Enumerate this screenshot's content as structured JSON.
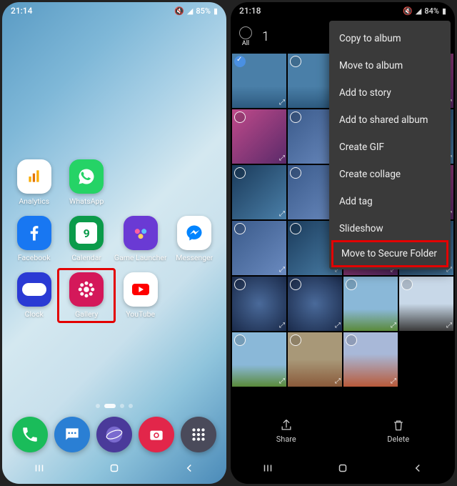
{
  "left": {
    "status": {
      "time": "21:14",
      "battery": "85%"
    },
    "apps": [
      {
        "name": "Analytics",
        "bg": "#fff",
        "icon": "analytics"
      },
      {
        "name": "WhatsApp",
        "bg": "#25d366",
        "icon": "whatsapp"
      },
      {
        "name": "Facebook",
        "bg": "#1877f2",
        "icon": "facebook"
      },
      {
        "name": "Calendar",
        "bg": "#0b9b4a",
        "icon": "calendar",
        "day": "9"
      },
      {
        "name": "Game Launcher",
        "bg": "#6a3ad4",
        "icon": "game"
      },
      {
        "name": "Messenger",
        "bg": "#fff",
        "icon": "messenger"
      },
      {
        "name": "Clock",
        "bg": "#2a3ad4",
        "icon": "clock"
      },
      {
        "name": "Gallery",
        "bg": "#d4185a",
        "icon": "gallery",
        "highlighted": true
      },
      {
        "name": "YouTube",
        "bg": "#fff",
        "icon": "youtube"
      }
    ],
    "dock": [
      {
        "name": "phone",
        "bg": "#1abc5a"
      },
      {
        "name": "messages",
        "bg": "#2a7fd4"
      },
      {
        "name": "browser",
        "bg": "#4a3a9a"
      },
      {
        "name": "camera",
        "bg": "#e2264a"
      },
      {
        "name": "apps",
        "bg": "#4a4a5a"
      }
    ]
  },
  "right": {
    "status": {
      "time": "21:18",
      "battery": "84%"
    },
    "select_all_label": "All",
    "selected_count": "1",
    "menu": [
      "Copy to album",
      "Move to album",
      "Add to story",
      "Add to shared album",
      "Create GIF",
      "Create collage",
      "Add tag",
      "Slideshow",
      "Move to Secure Folder"
    ],
    "menu_highlighted_index": 8,
    "actions": {
      "share": "Share",
      "delete": "Delete"
    },
    "thumbs": [
      {
        "cls": "t-ocean",
        "checked": true
      },
      {
        "cls": "t-ocean"
      },
      {
        "cls": "t-phone1"
      },
      {
        "cls": "t-phone2"
      },
      {
        "cls": "t-phone2"
      },
      {
        "cls": "t-phone3"
      },
      {
        "cls": "t-phone2"
      },
      {
        "cls": "t-phone1"
      },
      {
        "cls": "t-phone1"
      },
      {
        "cls": "t-phone3"
      },
      {
        "cls": "t-phone3"
      },
      {
        "cls": "t-phone2"
      },
      {
        "cls": "t-phone3"
      },
      {
        "cls": "t-phone1"
      },
      {
        "cls": "t-phone2"
      },
      {
        "cls": "t-phone1"
      },
      {
        "cls": "t-apps"
      },
      {
        "cls": "t-apps"
      },
      {
        "cls": "t-sky"
      },
      {
        "cls": "t-road"
      },
      {
        "cls": "t-sky"
      },
      {
        "cls": "t-field"
      },
      {
        "cls": "t-field2"
      }
    ]
  }
}
